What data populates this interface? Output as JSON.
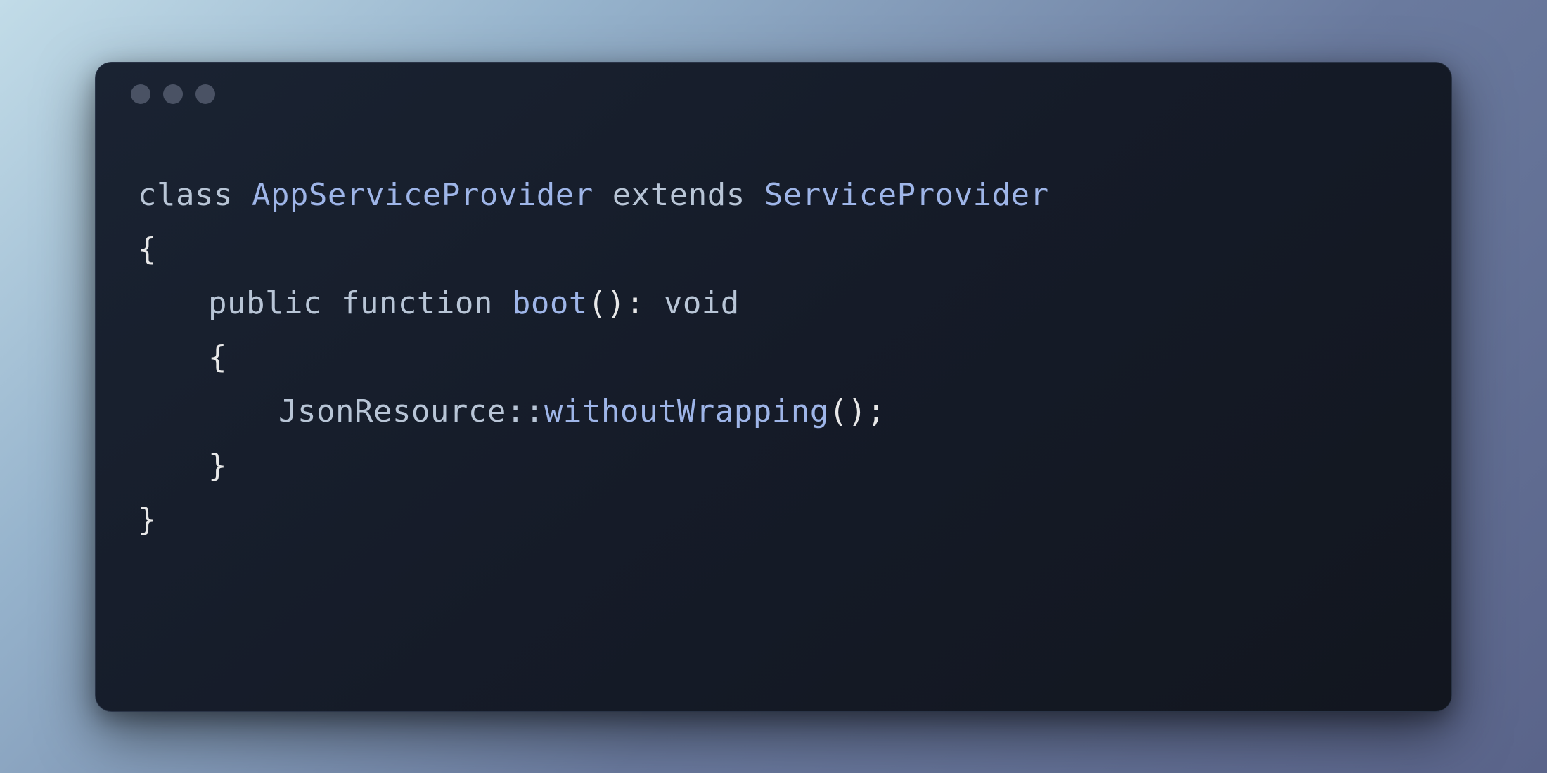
{
  "code": {
    "line1": {
      "kw_class": "class",
      "class_name": "AppServiceProvider",
      "kw_extends": "extends",
      "parent_class": "ServiceProvider"
    },
    "line2": {
      "brace_open": "{"
    },
    "line3": {
      "kw_public": "public",
      "kw_function": "function",
      "method_name": "boot",
      "parens": "()",
      "colon": ":",
      "return_type": "void"
    },
    "line4": {
      "brace_open": "{"
    },
    "line5": {
      "static_class": "JsonResource",
      "scope_op": "::",
      "call_name": "withoutWrapping",
      "parens": "()",
      "semicolon": ";"
    },
    "line6": {
      "brace_close": "}"
    },
    "line7": {
      "brace_close": "}"
    }
  },
  "colors": {
    "bg_gradient_start": "#c2dce8",
    "bg_gradient_end": "#5a648a",
    "window_bg": "#1a2332",
    "traffic_light": "#4a5264",
    "keyword": "#b8c5d6",
    "identifier": "#9eb5e8",
    "punctuation": "#e8e8e8"
  }
}
